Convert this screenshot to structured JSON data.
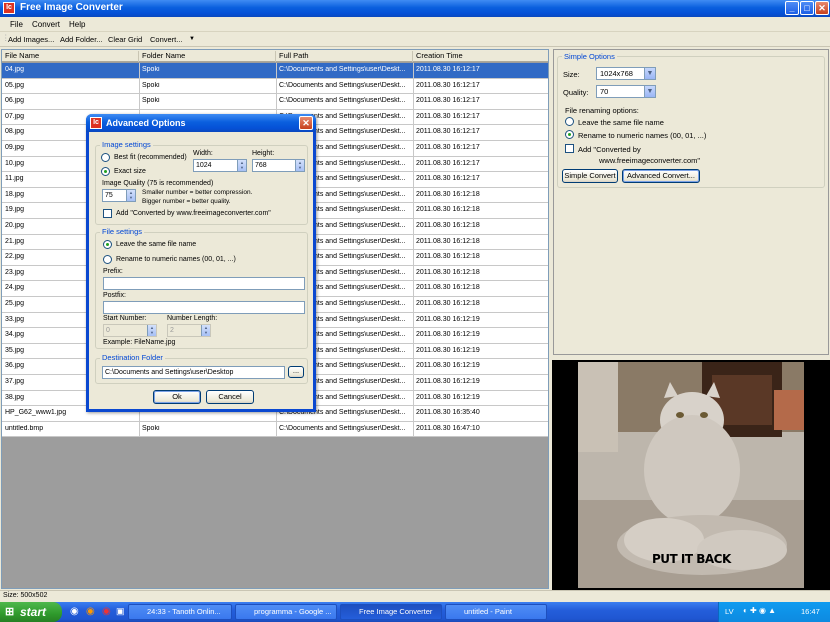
{
  "window": {
    "title": "Free Image Converter",
    "app_icon": "Ic"
  },
  "menu": [
    "File",
    "Convert",
    "Help"
  ],
  "toolbar": {
    "add_images": "Add Images...",
    "add_folder": "Add Folder...",
    "clear_grid": "Clear Grid",
    "convert": "Convert..."
  },
  "grid": {
    "columns": [
      "File Name",
      "Folder Name",
      "Full Path",
      "Creation Time"
    ],
    "rows": [
      [
        "04.jpg",
        "Spoki",
        "C:\\Documents and Settings\\user\\Deskt...",
        "2011.08.30 16:12:17"
      ],
      [
        "05.jpg",
        "Spoki",
        "C:\\Documents and Settings\\user\\Deskt...",
        "2011.08.30 16:12:17"
      ],
      [
        "06.jpg",
        "Spoki",
        "C:\\Documents and Settings\\user\\Deskt...",
        "2011.08.30 16:12:17"
      ],
      [
        "07.jpg",
        "",
        "C:\\Documents and Settings\\user\\Deskt...",
        "2011.08.30 16:12:17"
      ],
      [
        "08.jpg",
        "",
        "C:\\Documents and Settings\\user\\Deskt...",
        "2011.08.30 16:12:17"
      ],
      [
        "09.jpg",
        "",
        "C:\\Documents and Settings\\user\\Deskt...",
        "2011.08.30 16:12:17"
      ],
      [
        "10.jpg",
        "",
        "C:\\Documents and Settings\\user\\Deskt...",
        "2011.08.30 16:12:17"
      ],
      [
        "11.jpg",
        "",
        "C:\\Documents and Settings\\user\\Deskt...",
        "2011.08.30 16:12:17"
      ],
      [
        "18.jpg",
        "",
        "C:\\Documents and Settings\\user\\Deskt...",
        "2011.08.30 16:12:18"
      ],
      [
        "19.jpg",
        "",
        "C:\\Documents and Settings\\user\\Deskt...",
        "2011.08.30 16:12:18"
      ],
      [
        "20.jpg",
        "",
        "C:\\Documents and Settings\\user\\Deskt...",
        "2011.08.30 16:12:18"
      ],
      [
        "21.jpg",
        "",
        "C:\\Documents and Settings\\user\\Deskt...",
        "2011.08.30 16:12:18"
      ],
      [
        "22.jpg",
        "",
        "C:\\Documents and Settings\\user\\Deskt...",
        "2011.08.30 16:12:18"
      ],
      [
        "23.jpg",
        "",
        "C:\\Documents and Settings\\user\\Deskt...",
        "2011.08.30 16:12:18"
      ],
      [
        "24.jpg",
        "",
        "C:\\Documents and Settings\\user\\Deskt...",
        "2011.08.30 16:12:18"
      ],
      [
        "25.jpg",
        "",
        "C:\\Documents and Settings\\user\\Deskt...",
        "2011.08.30 16:12:18"
      ],
      [
        "33.jpg",
        "",
        "C:\\Documents and Settings\\user\\Deskt...",
        "2011.08.30 16:12:19"
      ],
      [
        "34.jpg",
        "",
        "C:\\Documents and Settings\\user\\Deskt...",
        "2011.08.30 16:12:19"
      ],
      [
        "35.jpg",
        "",
        "C:\\Documents and Settings\\user\\Deskt...",
        "2011.08.30 16:12:19"
      ],
      [
        "36.jpg",
        "",
        "C:\\Documents and Settings\\user\\Deskt...",
        "2011.08.30 16:12:19"
      ],
      [
        "37.jpg",
        "",
        "C:\\Documents and Settings\\user\\Deskt...",
        "2011.08.30 16:12:19"
      ],
      [
        "38.jpg",
        "",
        "C:\\Documents and Settings\\user\\Deskt...",
        "2011.08.30 16:12:19"
      ],
      [
        "HP_G62_www1.jpg",
        "",
        "C:\\Documents and Settings\\user\\Deskt...",
        "2011.08.30 16:35:40"
      ],
      [
        "untitled.bmp",
        "Spoki",
        "C:\\Documents and Settings\\user\\Deskt...",
        "2011.08.30 16:47:10"
      ]
    ]
  },
  "simple_options": {
    "title": "Simple Options",
    "size_label": "Size:",
    "size_value": "1024x768",
    "quality_label": "Quality:",
    "quality_value": "70",
    "renaming_label": "File renaming options:",
    "leave_same": "Leave the same file name",
    "rename_numeric": "Rename to numeric names (00, 01, ...)",
    "added_by_label": "Add \"Converted by",
    "added_by_url": "www.freeimageconverter.com\"",
    "simple_convert": "Simple Convert",
    "advanced_convert": "Advanced Convert..."
  },
  "dialog": {
    "title": "Advanced Options",
    "image_settings": "Image settings",
    "best_fit": "Best fit (recommended)",
    "exact_size": "Exact size",
    "width_label": "Width:",
    "width_value": "1024",
    "height_label": "Height:",
    "height_value": "768",
    "quality_label": "Image Quality (75 is recommended)",
    "quality_value": "75",
    "quality_hint1": "Smaller number = better compression.",
    "quality_hint2": "Bigger number = better quality.",
    "add_converted": "Add \"Converted by www.freeimageconverter.com\"",
    "file_settings": "File settings",
    "leave_same": "Leave the same file name",
    "rename_numeric": "Rename to numeric names (00, 01, ...)",
    "prefix_label": "Prefix:",
    "postfix_label": "Postfix:",
    "start_number_label": "Start Number:",
    "start_number_value": "0",
    "number_length_label": "Number Length:",
    "number_length_value": "2",
    "example": "Example: FileName.jpg",
    "destination_label": "Destination Folder",
    "destination_value": "C:\\Documents and Settings\\user\\Desktop",
    "browse": "...",
    "ok": "Ok",
    "cancel": "Cancel"
  },
  "photo": {
    "caption": "PUT IT BACK"
  },
  "status": {
    "size_text": "Size: 500x502"
  },
  "taskbar": {
    "start": "start",
    "tasks": [
      "24:33 - Tanoth Onlin...",
      "programma - Google ...",
      "Free Image Converter",
      "untitled - Paint"
    ],
    "language": "LV",
    "clock": "16:47"
  },
  "colors": {
    "selection": "#316ac5",
    "title_blue": "#0a5fde",
    "start_green": "#2f9a2c"
  }
}
